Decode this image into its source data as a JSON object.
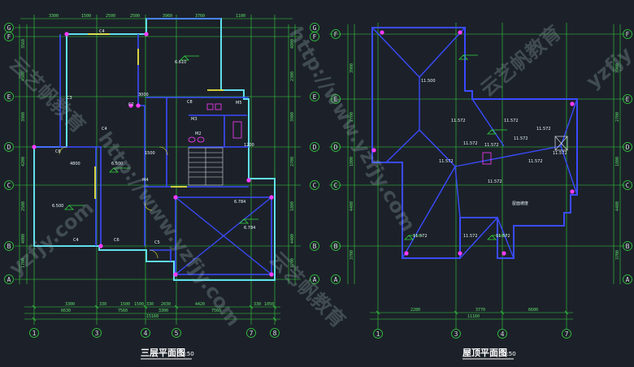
{
  "plans": [
    {
      "id": "third-floor",
      "title": "三层平面图",
      "scale": "1:50",
      "axis_rows": [
        "G",
        "F",
        "E",
        "D",
        "C",
        "B",
        "A"
      ],
      "axis_cols": [
        "1",
        "3",
        "4",
        "5",
        "7",
        "8"
      ],
      "room_labels": [
        "C4",
        "C3",
        "C4",
        "C2",
        "C6",
        "C8",
        "6.500",
        "6.610",
        "6.500",
        "6.784",
        "6.784",
        "C6",
        "C5",
        "C4",
        "M4",
        "M3",
        "M5",
        "M2",
        "1500",
        "4800",
        "1200",
        "3000"
      ],
      "dims_bottom_row1": [
        "3300",
        "330",
        "1500",
        "1500",
        "330",
        "2030",
        "4420",
        "330",
        "1050"
      ],
      "dims_bottom_row2": [
        "6630",
        "7560",
        "3300",
        "7560"
      ],
      "dims_bottom_total": "15160",
      "dims_top": [
        "3300",
        "1500",
        "2500",
        "2500",
        "3960",
        "3760",
        "1100"
      ],
      "dims_left": [
        "3560",
        "4500",
        "3900",
        "4200",
        "2500",
        "4800",
        "1700"
      ],
      "dims_right": [
        "4800",
        "2300",
        "3900",
        "2700",
        "1800",
        "4400",
        "3700"
      ]
    },
    {
      "id": "roof",
      "title": "屋顶平面图",
      "scale": "1:50",
      "axis_rows": [
        "F",
        "E",
        "D",
        "C",
        "B",
        "A"
      ],
      "axis_cols": [
        "1",
        "3",
        "4",
        "7"
      ],
      "room_labels": [
        "11.500",
        "11.572",
        "11.572",
        "11.572",
        "11.572",
        "11.572",
        "11.572",
        "11.572",
        "11.572",
        "11.572",
        "11.572",
        "11.572",
        "11.572",
        "11.572",
        "屋面坡度"
      ],
      "dims_bottom_row1": [
        "2280",
        "3770",
        "6600"
      ],
      "dims_bottom_total": "11160",
      "dims_left": [
        "3900",
        "2700",
        "1800",
        "4400",
        "3700"
      ]
    }
  ],
  "watermarks": [
    "云艺帆教育",
    "http://www.yzfjy.com",
    "云艺帆教育",
    "http://www.yzfjy.com",
    "yzfjy.com",
    "云艺帆教育",
    "yzfjy"
  ],
  "colors": {
    "background": "#1c2129",
    "walls": "#3a4bff",
    "axis_lines": "#33d43f",
    "outline": "#5fe0ec",
    "columns": "#ff3bff",
    "doors": "#e8e23a",
    "text": "#ffffff"
  }
}
